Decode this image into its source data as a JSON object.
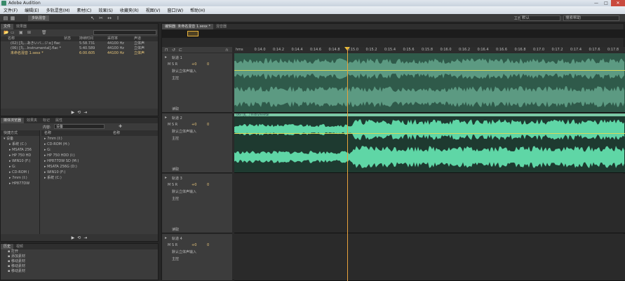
{
  "app": {
    "title": "Adobe Audition"
  },
  "window": {
    "min": "—",
    "max": "□",
    "close": "✕"
  },
  "menu": [
    "文件(F)",
    "编辑(E)",
    "多轨混音(M)",
    "素材(C)",
    "效果(S)",
    "收藏夹(R)",
    "视图(V)",
    "窗口(W)",
    "帮助(H)"
  ],
  "toolbar": {
    "workspace_label": "工作区:",
    "workspace_value": "默认",
    "search_placeholder": "搜索帮助"
  },
  "files_panel": {
    "tabs": [
      "文件",
      "效果器"
    ],
    "columns": [
      "名称",
      "状态",
      "持续时间",
      "采样率",
      "声道"
    ],
    "rows": [
      {
        "name": "(02) [丸...あきいバ...ジョ] flac",
        "duration": "5:58.731",
        "rate": "44100 Hz",
        "channels": "立体声"
      },
      {
        "name": "(06) [丸...Instrumental].flac *",
        "duration": "5:40.589",
        "rate": "44100 Hz",
        "channels": "立体声"
      },
      {
        "name": "未命名混音 1.sesx *",
        "duration": "6:00.605",
        "rate": "44100 Hz",
        "channels": "立体声"
      }
    ]
  },
  "media_panel": {
    "tabs": [
      "媒体浏览器",
      "效果夹",
      "标记",
      "属性"
    ],
    "content_label": "内容:",
    "content_value": "设备",
    "shortcut_label": "快捷方式",
    "tree": [
      "设备",
      "系统 (C:)",
      "MSATA 256",
      "HP 750 HD",
      "WIN10 (F:)",
      "G:",
      "CD-ROM (",
      "7mm (I:)",
      "HP877DW"
    ],
    "col_name": "名称",
    "col_type": "名称",
    "list": [
      "7mm (I:)",
      "CD-ROM (H:)",
      "G:",
      "HP 750 HDD (I:)",
      "HP877DW SD (M:)",
      "MSATA 256G (D:)",
      "WIN10 (F:)",
      "系统 (C:)"
    ]
  },
  "history_panel": {
    "tabs": [
      "历史",
      "视频"
    ],
    "items": [
      "打开",
      "添加素材",
      "移动素材",
      "移动素材",
      "移动素材"
    ]
  },
  "editor": {
    "tabs": [
      "编辑器: 未命名混音 1.sesx *",
      "混音器"
    ],
    "ruler": [
      "hms",
      "0:14.0",
      "0:14.2",
      "0:14.4",
      "0:14.6",
      "0:14.8",
      "0:15.0",
      "0:15.2",
      "0:15.4",
      "0:15.6",
      "0:15.8",
      "0:16.0",
      "0:16.2",
      "0:16.4",
      "0:16.6",
      "0:16.8",
      "0:17.0",
      "0:17.2",
      "0:17.4",
      "0:17.6",
      "0:17.8",
      "0:18.0"
    ],
    "tracks": [
      {
        "name": "轨道 1",
        "input": "默认立体声输入",
        "output": "主控",
        "mode": "读取",
        "vol": "+0",
        "pan": "0"
      },
      {
        "name": "轨道 2",
        "input": "默认立体声输入",
        "output": "主控",
        "mode": "读取",
        "vol": "+0",
        "pan": "0",
        "clip": "(06) [丸…] Instrumental"
      },
      {
        "name": "轨道 3",
        "input": "默认立体声输入",
        "output": "主控",
        "mode": "读取",
        "vol": "+0",
        "pan": "0"
      },
      {
        "name": "轨道 4",
        "input": "默认立体声输入",
        "output": "主控",
        "mode": "读取",
        "vol": "+0",
        "pan": "0"
      }
    ]
  },
  "colors": {
    "wave_dim": "#5c9a82",
    "wave_bright": "#5fd6a6",
    "playhead": "#e8a23c"
  }
}
